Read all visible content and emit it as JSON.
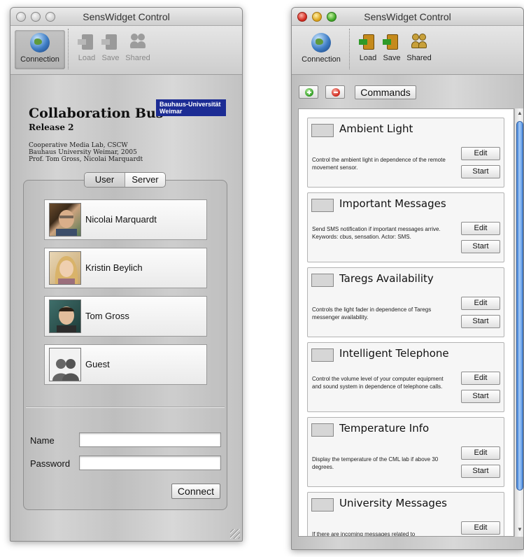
{
  "login_window": {
    "title": "SensWidget Control",
    "toolbar": {
      "connection_label": "Connection",
      "load_label": "Load",
      "save_label": "Save",
      "shared_label": "Shared"
    },
    "brand": {
      "title": "Collaboration Bus",
      "release": "Release 2",
      "university_badge_line1": "Bauhaus-Universität",
      "university_badge_line2": "Weimar",
      "credits_line1": "Cooperative Media Lab, CSCW",
      "credits_line2": "Bauhaus University Weimar, 2005",
      "credits_line3": "Prof. Tom Gross, Nicolai Marquardt"
    },
    "tabs": [
      "User",
      "Server"
    ],
    "active_tab": "User",
    "users": [
      {
        "name": "Nicolai Marquardt"
      },
      {
        "name": "Kristin Beylich"
      },
      {
        "name": "Tom Gross"
      },
      {
        "name": "Guest"
      }
    ],
    "form": {
      "name_label": "Name",
      "name_value": "",
      "password_label": "Password",
      "password_value": "",
      "connect_label": "Connect"
    }
  },
  "commands_window": {
    "title": "SensWidget Control",
    "toolbar": {
      "connection_label": "Connection",
      "load_label": "Load",
      "save_label": "Save",
      "shared_label": "Shared"
    },
    "commands_button_label": "Commands",
    "commands": [
      {
        "title": "Ambient Light",
        "description": "Control the ambient light in dependence of the remote movement sensor.",
        "edit_label": "Edit",
        "start_label": "Start"
      },
      {
        "title": "Important Messages",
        "description": "Send SMS notification if important messages arrive. Keywords: cbus, sensation. Actor: SMS.",
        "edit_label": "Edit",
        "start_label": "Start"
      },
      {
        "title": "Taregs Availability",
        "description": "Controls the light fader in dependence of Taregs messenger availability.",
        "edit_label": "Edit",
        "start_label": "Start"
      },
      {
        "title": "Intelligent Telephone",
        "description": "Control the volume level of your computer equipment and sound system in dependence of telephone calls.",
        "edit_label": "Edit",
        "start_label": "Start"
      },
      {
        "title": "Temperature Info",
        "description": "Display the temperature of the CML lab if above 30 degrees.",
        "edit_label": "Edit",
        "start_label": "Start"
      },
      {
        "title": "University Messages",
        "description": "If there are incoming messages related to",
        "edit_label": "Edit"
      }
    ]
  },
  "colors": {
    "university_badge": "#1c2c94",
    "scroll_thumb": "#3f7fd6",
    "add_button": "#2e9a20",
    "remove_button": "#cc2418"
  },
  "icons": {
    "connection": "globe-icon",
    "load": "load-icon",
    "save": "save-icon",
    "shared": "shared-icon",
    "add": "plus-icon",
    "remove": "minus-icon"
  }
}
